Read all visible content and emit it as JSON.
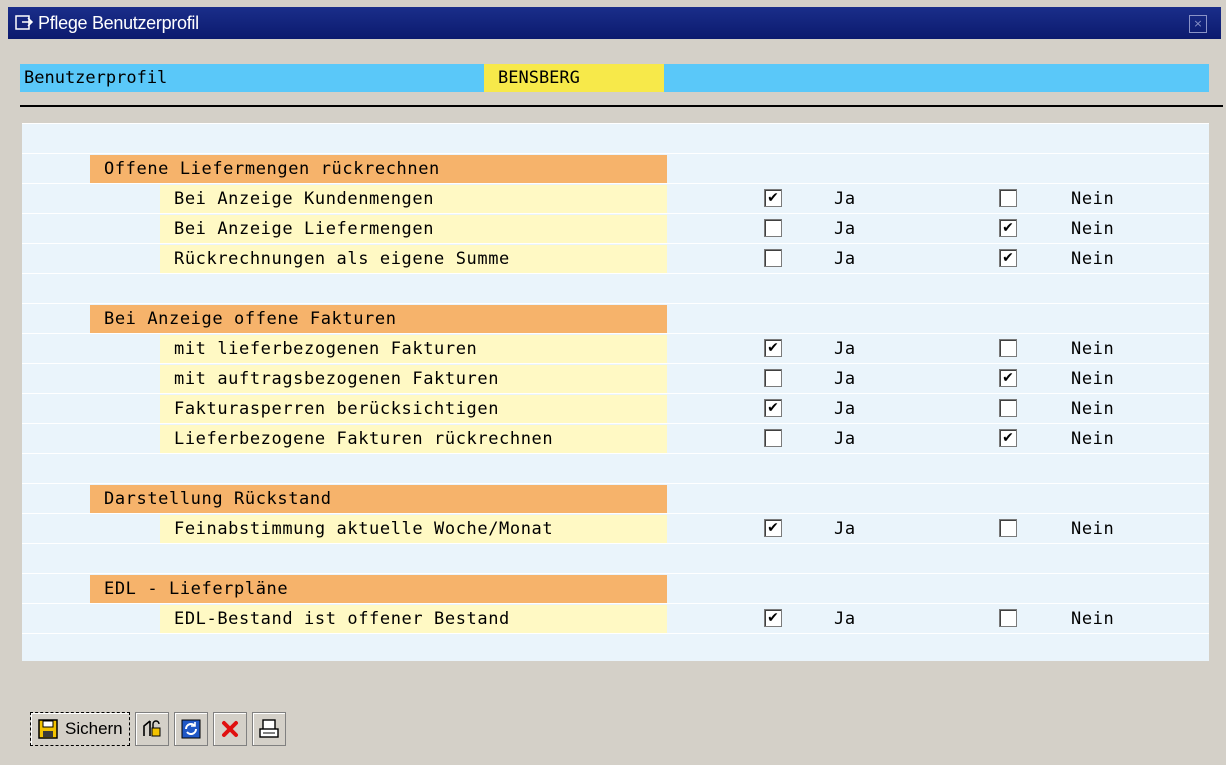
{
  "window": {
    "title": "Pflege Benutzerprofil",
    "icon": "window-icon",
    "close_icon": "close-icon",
    "close_glyph": "×"
  },
  "header": {
    "label": "Benutzerprofil",
    "value": "BENSBERG"
  },
  "groups": [
    {
      "title": "Offene Liefermengen rückrechnen",
      "items": [
        {
          "label": "Bei Anzeige Kundenmengen",
          "ja": true,
          "nein": false
        },
        {
          "label": "Bei Anzeige Liefermengen",
          "ja": false,
          "nein": true
        },
        {
          "label": "Rückrechnungen als eigene Summe",
          "ja": false,
          "nein": true
        }
      ]
    },
    {
      "title": "Bei Anzeige offene Fakturen",
      "items": [
        {
          "label": "mit lieferbezogenen Fakturen",
          "ja": true,
          "nein": false
        },
        {
          "label": "mit auftragsbezogenen Fakturen",
          "ja": false,
          "nein": true
        },
        {
          "label": "Fakturasperren berücksichtigen",
          "ja": true,
          "nein": false
        },
        {
          "label": "Lieferbezogene Fakturen rückrechnen",
          "ja": false,
          "nein": true
        }
      ]
    },
    {
      "title": "Darstellung Rückstand",
      "items": [
        {
          "label": "Feinabstimmung aktuelle Woche/Monat",
          "ja": true,
          "nein": false
        }
      ]
    },
    {
      "title": "EDL - Lieferpläne",
      "items": [
        {
          "label": "EDL-Bestand ist offener Bestand",
          "ja": true,
          "nein": false
        }
      ]
    }
  ],
  "option_labels": {
    "ja": "Ja",
    "nein": "Nein"
  },
  "check_glyph": "✔",
  "toolbar": {
    "save_label": "Sichern",
    "icons": [
      "save-icon",
      "change-icon",
      "refresh-icon",
      "cancel-icon",
      "print-icon"
    ]
  },
  "colors": {
    "header_blue": "#5ac8f9",
    "header_value": "#f7e94a",
    "group_orange": "#f6b36b",
    "item_yellow": "#fff9c4",
    "panel_bg": "#eaf4fb"
  }
}
